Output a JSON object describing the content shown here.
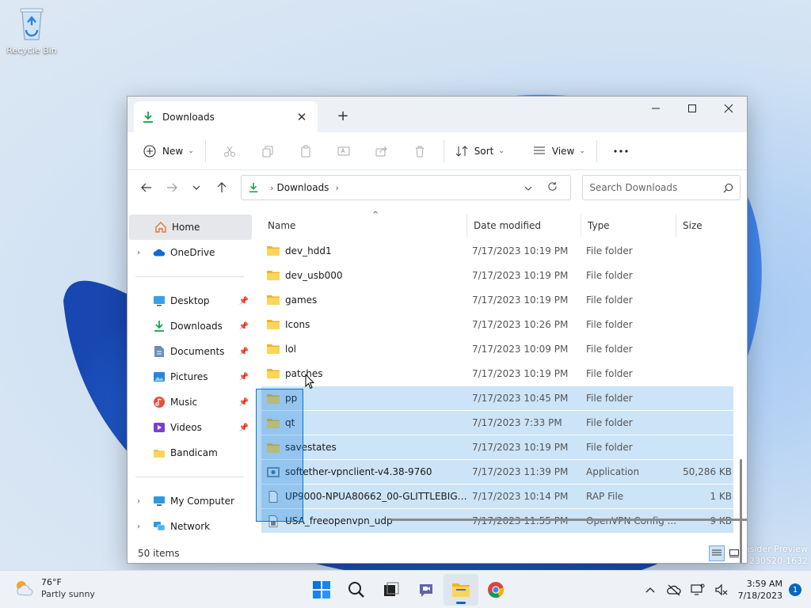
{
  "desktop": {
    "recycle_bin_label": "Recycle Bin",
    "watermark_line1": "nsider Preview",
    "watermark_line2": "e.230520-1632"
  },
  "window": {
    "tab_title": "Downloads",
    "accent_color": "#0078d7",
    "toolbar": {
      "new_label": "New",
      "sort_label": "Sort",
      "view_label": "View",
      "more_icon": "more-icon"
    },
    "address": {
      "crumb": "Downloads",
      "search_placeholder": "Search Downloads"
    },
    "nav": {
      "home": "Home",
      "onedrive": "OneDrive",
      "quick": [
        {
          "label": "Desktop",
          "icon": "desktop-icon",
          "pinned": true
        },
        {
          "label": "Downloads",
          "icon": "downloads-icon",
          "pinned": true
        },
        {
          "label": "Documents",
          "icon": "documents-icon",
          "pinned": true
        },
        {
          "label": "Pictures",
          "icon": "pictures-icon",
          "pinned": true
        },
        {
          "label": "Music",
          "icon": "music-icon",
          "pinned": true
        },
        {
          "label": "Videos",
          "icon": "videos-icon",
          "pinned": true
        },
        {
          "label": "Bandicam",
          "icon": "folder-icon",
          "pinned": false
        }
      ],
      "my_computer": "My Computer",
      "network": "Network"
    },
    "columns": {
      "name": "Name",
      "date": "Date modified",
      "type": "Type",
      "size": "Size"
    },
    "files": [
      {
        "name": "dev_hdd1",
        "date": "7/17/2023 10:19 PM",
        "type": "File folder",
        "size": "",
        "icon": "folder",
        "selected": false
      },
      {
        "name": "dev_usb000",
        "date": "7/17/2023 10:19 PM",
        "type": "File folder",
        "size": "",
        "icon": "folder",
        "selected": false
      },
      {
        "name": "games",
        "date": "7/17/2023 10:19 PM",
        "type": "File folder",
        "size": "",
        "icon": "folder",
        "selected": false
      },
      {
        "name": "Icons",
        "date": "7/17/2023 10:26 PM",
        "type": "File folder",
        "size": "",
        "icon": "folder",
        "selected": false
      },
      {
        "name": "lol",
        "date": "7/17/2023 10:09 PM",
        "type": "File folder",
        "size": "",
        "icon": "folder",
        "selected": false
      },
      {
        "name": "patches",
        "date": "7/17/2023 10:19 PM",
        "type": "File folder",
        "size": "",
        "icon": "folder",
        "selected": false
      },
      {
        "name": "pp",
        "date": "7/17/2023 10:45 PM",
        "type": "File folder",
        "size": "",
        "icon": "folder",
        "selected": true
      },
      {
        "name": "qt",
        "date": "7/17/2023 7:33 PM",
        "type": "File folder",
        "size": "",
        "icon": "folder",
        "selected": true
      },
      {
        "name": "savestates",
        "date": "7/17/2023 10:19 PM",
        "type": "File folder",
        "size": "",
        "icon": "folder",
        "selected": true
      },
      {
        "name": "softether-vpnclient-v4.38-9760",
        "date": "7/17/2023 11:39 PM",
        "type": "Application",
        "size": "50,286 KB",
        "icon": "app",
        "selected": true
      },
      {
        "name": "UP9000-NPUA80662_00-GLITTLEBIG00000...",
        "date": "7/17/2023 10:14 PM",
        "type": "RAP File",
        "size": "1 KB",
        "icon": "file",
        "selected": true
      },
      {
        "name": "USA_freeopenvpn_udp",
        "date": "7/17/2023 11:55 PM",
        "type": "OpenVPN Config ...",
        "size": "9 KB",
        "icon": "config",
        "selected": true
      }
    ],
    "status": "50 items"
  },
  "taskbar": {
    "weather_temp": "76°F",
    "weather_cond": "Partly sunny",
    "time": "3:59 AM",
    "date": "7/18/2023",
    "notifications": "1"
  }
}
